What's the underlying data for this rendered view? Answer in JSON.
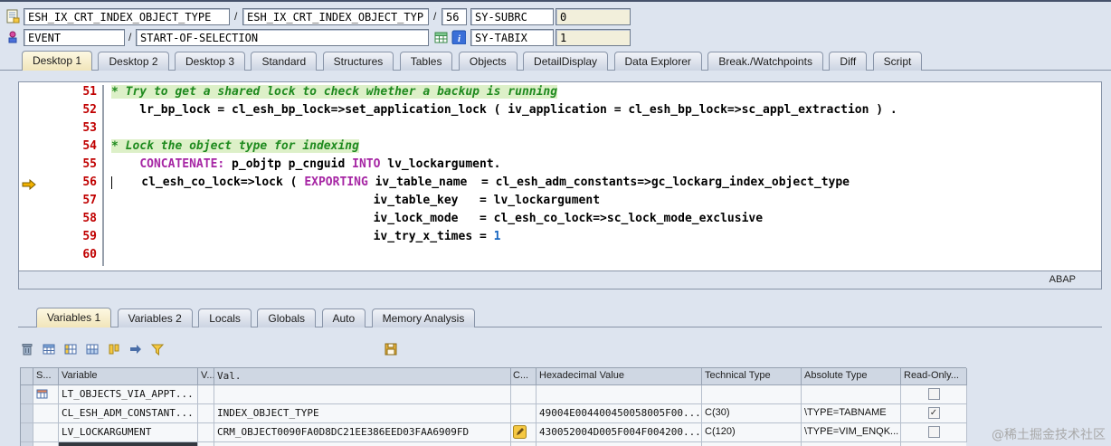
{
  "colors": {
    "window_background": "#dde4ef",
    "keyword": "#a626a4",
    "comment": "#1e8a1e",
    "literal": "#1565c0",
    "line_number": "#c00000",
    "active_tab": "#f7efcf",
    "readonly_field": "#f2efdb"
  },
  "topbar": {
    "slash": "/",
    "row1": {
      "field1": "ESH_IX_CRT_INDEX_OBJECT_TYPE",
      "field2": "ESH_IX_CRT_INDEX_OBJECT_TYPE",
      "field3": "56",
      "sy_subrc_label": "SY-SUBRC",
      "sy_subrc_value": "0"
    },
    "row2": {
      "field1": "EVENT",
      "field2": "START-OF-SELECTION",
      "sy_tabix_label": "SY-TABIX",
      "sy_tabix_value": "1"
    },
    "icons": [
      "program-icon",
      "event-icon",
      "structure-display-icon",
      "info-icon"
    ]
  },
  "desktop_tabs": [
    "Desktop 1",
    "Desktop 2",
    "Desktop 3",
    "Standard",
    "Structures",
    "Tables",
    "Objects",
    "DetailDisplay",
    "Data Explorer",
    "Break./Watchpoints",
    "Diff",
    "Script"
  ],
  "desktop_tabs_active": "Desktop 1",
  "editor": {
    "status_label": "ABAP",
    "current_line": 56,
    "lines": [
      {
        "num": "51",
        "tokens": [
          {
            "s": "cmt",
            "t": "* Try to get a shared lock to check whether a backup is running"
          }
        ]
      },
      {
        "num": "52",
        "tokens": [
          {
            "s": "txt",
            "t": "    lr_bp_lock = cl_esh_bp_lock=>set_application_lock ( iv_application = cl_esh_bp_lock=>sc_appl_extraction ) ."
          }
        ]
      },
      {
        "num": "53",
        "tokens": []
      },
      {
        "num": "54",
        "tokens": [
          {
            "s": "cmt",
            "t": "* Lock the object type for indexing"
          }
        ]
      },
      {
        "num": "55",
        "tokens": [
          {
            "s": "txt",
            "t": "    "
          },
          {
            "s": "kw",
            "t": "CONCATENATE:"
          },
          {
            "s": "txt",
            "t": " p_objtp p_cnguid "
          },
          {
            "s": "kw",
            "t": "INTO"
          },
          {
            "s": "txt",
            "t": " lv_lockargument."
          }
        ]
      },
      {
        "num": "56",
        "tokens": [
          {
            "s": "txt",
            "t": "    cl_esh_co_lock=>lock ( "
          },
          {
            "s": "kw",
            "t": "EXPORTING"
          },
          {
            "s": "txt",
            "t": " iv_table_name  = cl_esh_adm_constants=>gc_lockarg_index_object_type"
          }
        ]
      },
      {
        "num": "57",
        "tokens": [
          {
            "s": "txt",
            "t": "                                     iv_table_key   = lv_lockargument"
          }
        ]
      },
      {
        "num": "58",
        "tokens": [
          {
            "s": "txt",
            "t": "                                     iv_lock_mode   = cl_esh_co_lock=>sc_lock_mode_exclusive"
          }
        ]
      },
      {
        "num": "59",
        "tokens": [
          {
            "s": "txt",
            "t": "                                     iv_try_x_times = "
          },
          {
            "s": "lit",
            "t": "1"
          }
        ]
      },
      {
        "num": "60",
        "tokens": []
      }
    ]
  },
  "variable_tabs": [
    "Variables 1",
    "Variables 2",
    "Locals",
    "Globals",
    "Auto",
    "Memory Analysis"
  ],
  "variable_tabs_active": "Variables 1",
  "toolbar_icons": [
    "delete-icon",
    "table-settings-icon",
    "table-select-icon",
    "table-columns-icon",
    "sort-icon",
    "swap-icon",
    "filter-icon",
    "save-layout-icon"
  ],
  "table": {
    "columns": [
      "",
      "S...",
      "Variable",
      "V...",
      "Val.",
      "C...",
      "Hexadecimal Value",
      "Technical Type",
      "Absolute Type",
      "Read-Only..."
    ],
    "rows": [
      {
        "type_icon": "table-type-icon",
        "variable": "LT_OBJECTS_VIA_APPT...",
        "val": "",
        "hex": "",
        "tech": "",
        "abs": "",
        "readonly_mark": ""
      },
      {
        "type_icon": "",
        "variable": "CL_ESH_ADM_CONSTANT...",
        "val": "INDEX_OBJECT_TYPE",
        "hex": "49004E004400450058005F00...",
        "tech": "C(30)",
        "abs": "\\TYPE=TABNAME",
        "readonly_mark": "✓"
      },
      {
        "type_icon": "",
        "variable": "LV_LOCKARGUMENT",
        "val": "CRM_OBJECT0090FA0D8DC21EE386EED03FAA6909FD",
        "edit_icon": "pencil-icon",
        "hex": "430052004D005F004F004200...",
        "tech": "C(120)",
        "abs": "\\TYPE=VIM_ENQK...",
        "readonly_mark": ""
      }
    ]
  },
  "watermark": "@稀土掘金技术社区"
}
